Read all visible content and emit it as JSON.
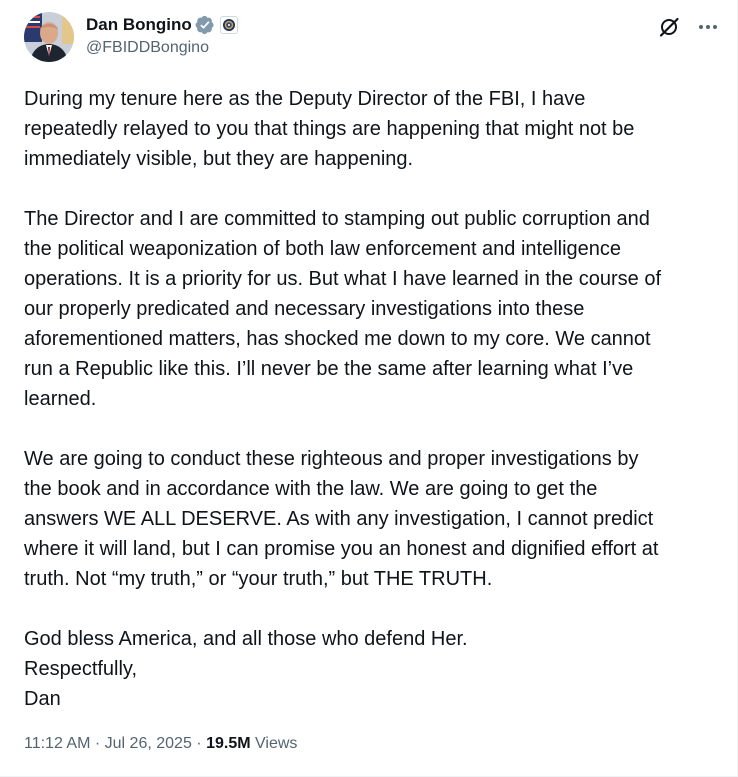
{
  "author": {
    "display_name": "Dan Bongino",
    "handle": "@FBIDDBongino"
  },
  "tweet": {
    "paragraphs": [
      [
        "During my tenure here as the Deputy Director of the FBI, I have",
        "repeatedly relayed to you that things are happening that might not be",
        "immediately visible, but they are happening."
      ],
      [
        "The Director and I are committed to stamping out public corruption and",
        "the political weaponization of both law enforcement and intelligence",
        "operations. It is a priority for us. But what I have learned in the course of",
        "our properly predicated and necessary investigations into these",
        "aforementioned matters, has shocked me down to my core. We cannot",
        "run a Republic like this. I’ll never be the same after learning what I’ve",
        "learned."
      ],
      [
        "We are going to conduct these righteous and proper investigations by",
        "the book and in accordance with the law. We are going to get the",
        "answers WE ALL DESERVE. As with any investigation, I cannot predict",
        "where it will land, but I can promise you an honest and dignified effort at",
        "truth. Not “my truth,” or “your truth,” but THE TRUTH."
      ],
      [
        "God bless America, and all those who defend Her.",
        "Respectfully,",
        "Dan"
      ]
    ]
  },
  "meta": {
    "time": "11:12 AM",
    "separator": "·",
    "date": "Jul 26, 2025",
    "views_count": "19.5M",
    "views_label": "Views"
  },
  "icons": {
    "verified": "verified-badge-icon",
    "affiliate": "fbi-seal-affiliate-icon",
    "grok": "grok-icon",
    "more": "more-options-icon"
  },
  "colors": {
    "text_primary": "#0f1419",
    "text_secondary": "#536471",
    "verified_badge": "#829aab"
  }
}
